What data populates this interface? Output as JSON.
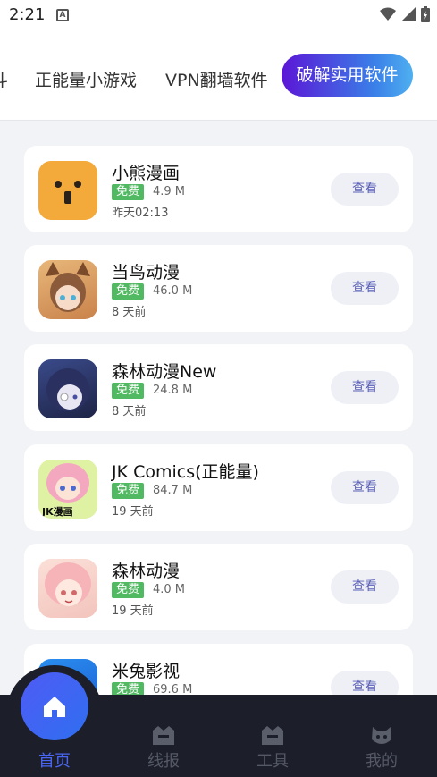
{
  "status": {
    "time": "2:21"
  },
  "tabs": [
    {
      "label": "斗"
    },
    {
      "label": "正能量小游戏"
    },
    {
      "label": "VPN翻墙软件"
    },
    {
      "label": "破解实用软件"
    }
  ],
  "apps": [
    {
      "name": "小熊漫画",
      "badge": "免费",
      "size": "4.9 M",
      "date": "昨天02:13",
      "action": "查看"
    },
    {
      "name": "当鸟动漫",
      "badge": "免费",
      "size": "46.0 M",
      "date": "8 天前",
      "action": "查看"
    },
    {
      "name": "森林动漫New",
      "badge": "免费",
      "size": "24.8 M",
      "date": "8 天前",
      "action": "查看"
    },
    {
      "name": "JK Comics(正能量)",
      "badge": "免费",
      "size": "84.7 M",
      "date": "19 天前",
      "action": "查看",
      "icon_text": "JK漫画"
    },
    {
      "name": "森林动漫",
      "badge": "免费",
      "size": "4.0 M",
      "date": "19 天前",
      "action": "查看"
    },
    {
      "name": "米兔影视",
      "badge": "免费",
      "size": "69.6 M",
      "date": "",
      "action": "查看"
    }
  ],
  "nav": [
    {
      "label": "首页",
      "icon": "home-icon",
      "active": true
    },
    {
      "label": "线报",
      "icon": "crown-icon"
    },
    {
      "label": "工具",
      "icon": "crown-icon"
    },
    {
      "label": "我的",
      "icon": "cat-face-icon"
    }
  ],
  "colors": {
    "accent_start": "#5b16d6",
    "accent_end": "#4fb0f0",
    "badge": "#52b963",
    "nav_bg": "#1c1e29",
    "nav_active": "#4a66f0"
  }
}
